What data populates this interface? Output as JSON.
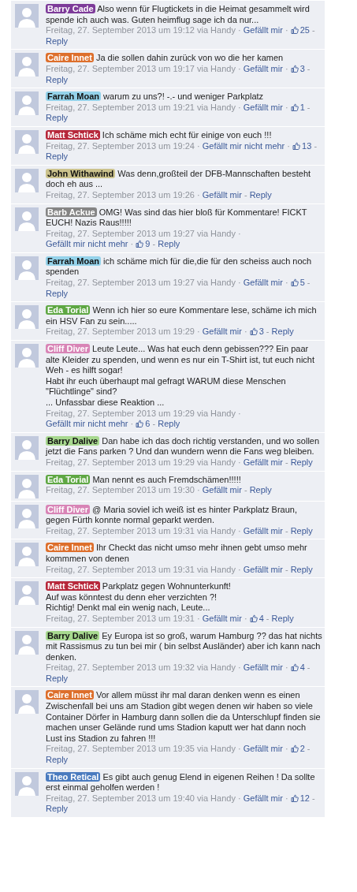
{
  "comments": [
    {
      "author": "Barry Cade",
      "color": "#7d3a99",
      "text": "Also wenn für Flugtickets in die Heimat gesammelt wird spende ich auch was. Guten heimflug sage ich da nur...",
      "meta": [
        {
          "kind": "date",
          "text": "Freitag, 27. September 2013 um 19:12 via Handy"
        },
        {
          "kind": "sep",
          "text": "·"
        },
        {
          "kind": "link",
          "text": "Gefällt mir"
        },
        {
          "kind": "sep",
          "text": "·"
        },
        {
          "kind": "likes",
          "text": "25"
        },
        {
          "kind": "sep",
          "text": "-"
        },
        {
          "kind": "link",
          "text": "Reply"
        }
      ]
    },
    {
      "author": "Caire Innet",
      "color": "#dd6f2c",
      "text": "Ja die sollen dahin zurück von wo die her kamen",
      "meta": [
        {
          "kind": "date",
          "text": "Freitag, 27. September 2013 um 19:17 via Handy"
        },
        {
          "kind": "sep",
          "text": "·"
        },
        {
          "kind": "link",
          "text": "Gefällt mir"
        },
        {
          "kind": "sep",
          "text": "·"
        },
        {
          "kind": "likes",
          "text": "3"
        },
        {
          "kind": "sep",
          "text": "-"
        },
        {
          "kind": "link",
          "text": "Reply"
        }
      ]
    },
    {
      "author": "Farrah Moan",
      "color": "#94d2ea",
      "text": "warum zu uns?! -.- und weniger Parkplatz",
      "meta": [
        {
          "kind": "date",
          "text": "Freitag, 27. September 2013 um 19:21 via Handy"
        },
        {
          "kind": "sep",
          "text": "·"
        },
        {
          "kind": "link",
          "text": "Gefällt mir"
        },
        {
          "kind": "sep",
          "text": "·"
        },
        {
          "kind": "likes",
          "text": "1"
        },
        {
          "kind": "sep",
          "text": "-"
        },
        {
          "kind": "link",
          "text": "Reply"
        }
      ]
    },
    {
      "author": "Matt Schtick",
      "color": "#b7283b",
      "text": "Ich schäme mich echt für einige von euch !!!",
      "meta": [
        {
          "kind": "date",
          "text": "Freitag, 27. September 2013 um 19:24"
        },
        {
          "kind": "sep",
          "text": "·"
        },
        {
          "kind": "link",
          "text": "Gefällt mir nicht mehr"
        },
        {
          "kind": "sep",
          "text": "·"
        },
        {
          "kind": "likes",
          "text": "13"
        },
        {
          "kind": "sep",
          "text": "-"
        },
        {
          "kind": "link",
          "text": "Reply"
        }
      ]
    },
    {
      "author": "John Withawind",
      "color": "#cbc28c",
      "text": "Was denn,großteil der DFB-Mannschaften besteht doch eh aus ...",
      "meta": [
        {
          "kind": "date",
          "text": "Freitag, 27. September 2013 um 19:26"
        },
        {
          "kind": "sep",
          "text": "·"
        },
        {
          "kind": "link",
          "text": "Gefällt mir"
        },
        {
          "kind": "sep",
          "text": "-"
        },
        {
          "kind": "link",
          "text": "Reply"
        }
      ]
    },
    {
      "author": "Barb Ackue",
      "color": "#858585",
      "text": "OMG! Was sind das hier bloß für Kommentare! FICKT EUCH! Nazis Raus!!!!!",
      "meta": [
        {
          "kind": "date",
          "text": "Freitag, 27. September 2013 um 19:27 via Handy"
        },
        {
          "kind": "sep",
          "text": "·"
        },
        {
          "kind": "link",
          "text": "Gefällt mir nicht mehr"
        },
        {
          "kind": "sep",
          "text": "·"
        },
        {
          "kind": "likes",
          "text": "9"
        },
        {
          "kind": "sep",
          "text": "-"
        },
        {
          "kind": "link",
          "text": "Reply"
        }
      ]
    },
    {
      "author": "Farrah Moan",
      "color": "#94d2ea",
      "text": "ich schäme mich für die,die für den scheiss auch noch spenden",
      "meta": [
        {
          "kind": "date",
          "text": "Freitag, 27. September 2013 um 19:27 via Handy"
        },
        {
          "kind": "sep",
          "text": "·"
        },
        {
          "kind": "link",
          "text": "Gefällt mir"
        },
        {
          "kind": "sep",
          "text": "·"
        },
        {
          "kind": "likes",
          "text": "5"
        },
        {
          "kind": "sep",
          "text": "-"
        },
        {
          "kind": "link",
          "text": "Reply"
        }
      ]
    },
    {
      "author": "Eda Torial",
      "color": "#5ea743",
      "text": "Wenn ich hier so eure Kommentare lese, schäme ich mich ein HSV Fan zu sein.....",
      "meta": [
        {
          "kind": "date",
          "text": "Freitag, 27. September 2013 um 19:29"
        },
        {
          "kind": "sep",
          "text": "·"
        },
        {
          "kind": "link",
          "text": "Gefällt mir"
        },
        {
          "kind": "sep",
          "text": "·"
        },
        {
          "kind": "likes",
          "text": "3"
        },
        {
          "kind": "sep",
          "text": "-"
        },
        {
          "kind": "link",
          "text": "Reply"
        }
      ]
    },
    {
      "author": "Cliff Diver",
      "color": "#d884b6",
      "text": "Leute Leute... Was hat euch denn gebissen??? Ein paar alte Kleider zu spenden, und wenn es nur ein T-Shirt ist, tut euch nicht Weh - es hilft sogar!\nHabt ihr euch überhaupt mal gefragt WARUM diese Menschen \"Flüchtlinge\" sind?\n... Unfassbar diese Reaktion ...",
      "meta": [
        {
          "kind": "date",
          "text": "Freitag, 27. September 2013 um 19:29 via Handy"
        },
        {
          "kind": "sep",
          "text": "·"
        },
        {
          "kind": "link",
          "text": "Gefällt mir nicht mehr"
        },
        {
          "kind": "sep",
          "text": "·"
        },
        {
          "kind": "likes",
          "text": "6"
        },
        {
          "kind": "sep",
          "text": "-"
        },
        {
          "kind": "link",
          "text": "Reply"
        }
      ]
    },
    {
      "author": "Barry Dalive",
      "color": "#a7d88f",
      "text": "Dan habe ich das doch richtig verstanden, und wo sollen jetzt die Fans parken ? Und dan wundern wenn die Fans weg bleiben.",
      "meta": [
        {
          "kind": "date",
          "text": "Freitag, 27. September 2013 um 19:29 via Handy"
        },
        {
          "kind": "sep",
          "text": "·"
        },
        {
          "kind": "link",
          "text": "Gefällt mir"
        },
        {
          "kind": "sep",
          "text": "-"
        },
        {
          "kind": "link",
          "text": "Reply"
        }
      ]
    },
    {
      "author": "Eda Torial",
      "color": "#5ea743",
      "text": "Man nennt es auch Fremdschämen!!!!!",
      "meta": [
        {
          "kind": "date",
          "text": "Freitag, 27. September 2013 um 19:30"
        },
        {
          "kind": "sep",
          "text": "·"
        },
        {
          "kind": "link",
          "text": "Gefällt mir"
        },
        {
          "kind": "sep",
          "text": "-"
        },
        {
          "kind": "link",
          "text": "Reply"
        }
      ]
    },
    {
      "author": "Cliff Diver",
      "color": "#d884b6",
      "text": "@ Maria soviel ich weiß ist es hinter Parkplatz Braun, gegen Fürth konnte normal geparkt werden.",
      "meta": [
        {
          "kind": "date",
          "text": "Freitag, 27. September 2013 um 19:31 via Handy"
        },
        {
          "kind": "sep",
          "text": "·"
        },
        {
          "kind": "link",
          "text": "Gefällt mir"
        },
        {
          "kind": "sep",
          "text": "-"
        },
        {
          "kind": "link",
          "text": "Reply"
        }
      ]
    },
    {
      "author": "Caire Innet",
      "color": "#dd6f2c",
      "text": "Ihr Checkt das nicht umso mehr ihnen gebt umso mehr kommmen von denen",
      "meta": [
        {
          "kind": "date",
          "text": "Freitag, 27. September 2013 um 19:31 via Handy"
        },
        {
          "kind": "sep",
          "text": "·"
        },
        {
          "kind": "link",
          "text": "Gefällt mir"
        },
        {
          "kind": "sep",
          "text": "-"
        },
        {
          "kind": "link",
          "text": "Reply"
        }
      ]
    },
    {
      "author": "Matt Schtick",
      "color": "#b7283b",
      "text": "Parkplatz gegen Wohnunterkunft!\nAuf was könntest du denn eher verzichten ?!\nRichtig! Denkt mal ein wenig nach, Leute...",
      "meta": [
        {
          "kind": "date",
          "text": "Freitag, 27. September 2013 um 19:31"
        },
        {
          "kind": "sep",
          "text": "·"
        },
        {
          "kind": "link",
          "text": "Gefällt mir"
        },
        {
          "kind": "sep",
          "text": "·"
        },
        {
          "kind": "likes",
          "text": "4"
        },
        {
          "kind": "sep",
          "text": "-"
        },
        {
          "kind": "link",
          "text": "Reply"
        }
      ]
    },
    {
      "author": "Barry Dalive",
      "color": "#a7d88f",
      "text": "Ey Europa ist so groß, warum Hamburg ?? das hat nichts mit Rassismus zu tun bei mir ( bin selbst Ausländer) aber ich kann nach denken.",
      "meta": [
        {
          "kind": "date",
          "text": "Freitag, 27. September 2013 um 19:32 via Handy"
        },
        {
          "kind": "sep",
          "text": "·"
        },
        {
          "kind": "link",
          "text": "Gefällt mir"
        },
        {
          "kind": "sep",
          "text": "·"
        },
        {
          "kind": "likes",
          "text": "4"
        },
        {
          "kind": "sep",
          "text": "-"
        },
        {
          "kind": "link",
          "text": "Reply"
        }
      ]
    },
    {
      "author": "Caire Innet",
      "color": "#dd6f2c",
      "text": "Vor allem müsst ihr mal daran denken wenn es einen Zwischenfall bei uns am Stadion gibt wegen denen wir haben so viele Container Dörfer in Hamburg dann sollen die da Unterschlupf finden sie machen unser Gelände rund ums Stadion kaputt wer hat dann noch Lust ins Stadion zu fahren !!!",
      "meta": [
        {
          "kind": "date",
          "text": "Freitag, 27. September 2013 um 19:35 via Handy"
        },
        {
          "kind": "sep",
          "text": "·"
        },
        {
          "kind": "link",
          "text": "Gefällt mir"
        },
        {
          "kind": "sep",
          "text": "·"
        },
        {
          "kind": "likes",
          "text": "2"
        },
        {
          "kind": "sep",
          "text": "-"
        },
        {
          "kind": "link",
          "text": "Reply"
        }
      ]
    },
    {
      "author": "Theo Retical",
      "color": "#4a7bbf",
      "text": "Es gibt auch genug Elend in eigenen Reihen ! Da sollte erst einmal geholfen werden !",
      "meta": [
        {
          "kind": "date",
          "text": "Freitag, 27. September 2013 um 19:40 via Handy"
        },
        {
          "kind": "sep",
          "text": "·"
        },
        {
          "kind": "link",
          "text": "Gefällt mir"
        },
        {
          "kind": "sep",
          "text": "·"
        },
        {
          "kind": "likes",
          "text": "12"
        },
        {
          "kind": "sep",
          "text": "-"
        },
        {
          "kind": "link",
          "text": "Reply"
        }
      ]
    }
  ]
}
